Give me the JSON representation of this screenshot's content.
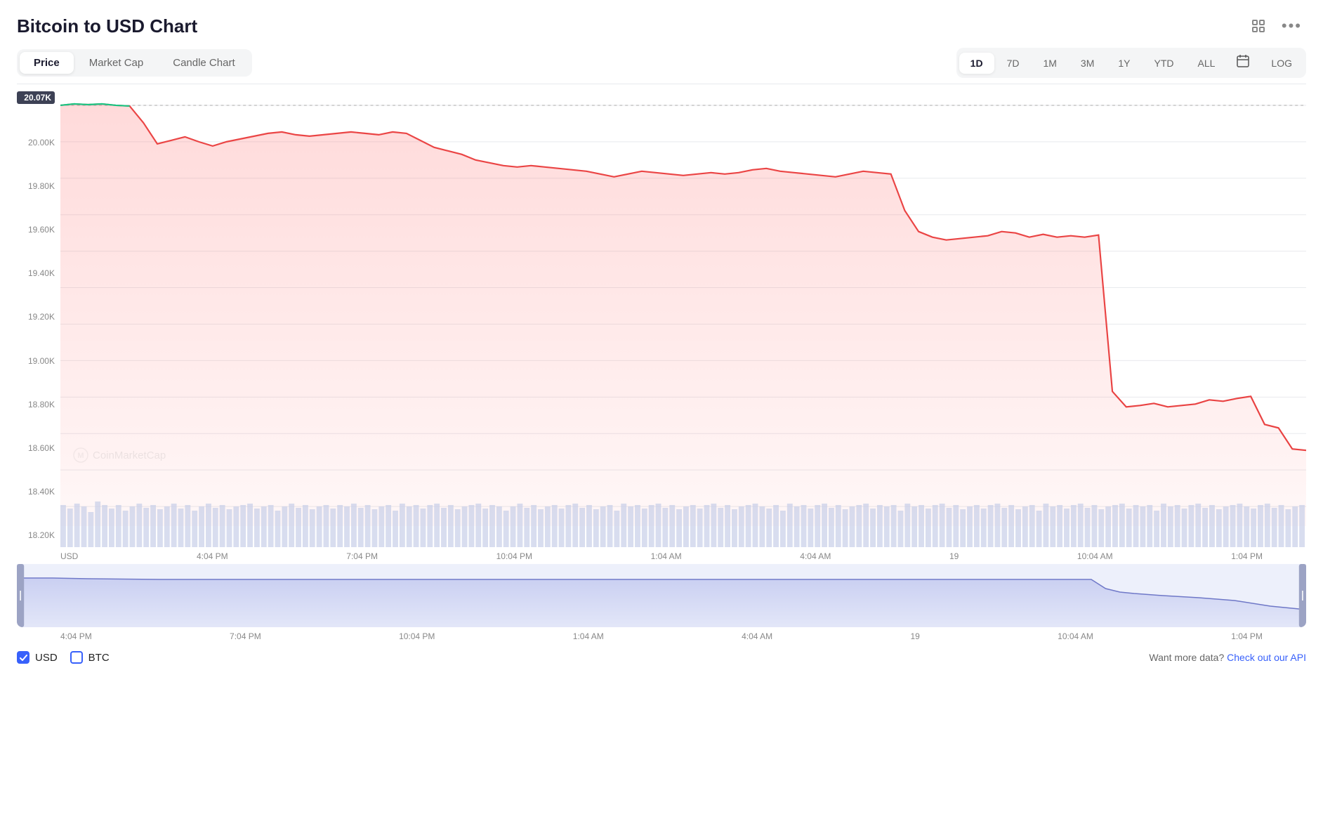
{
  "page": {
    "title": "Bitcoin to USD Chart"
  },
  "tabs": [
    {
      "id": "price",
      "label": "Price",
      "active": true
    },
    {
      "id": "market-cap",
      "label": "Market Cap",
      "active": false
    },
    {
      "id": "candle-chart",
      "label": "Candle Chart",
      "active": false
    }
  ],
  "time_periods": [
    {
      "id": "1d",
      "label": "1D",
      "active": true
    },
    {
      "id": "7d",
      "label": "7D",
      "active": false
    },
    {
      "id": "1m",
      "label": "1M",
      "active": false
    },
    {
      "id": "3m",
      "label": "3M",
      "active": false
    },
    {
      "id": "1y",
      "label": "1Y",
      "active": false
    },
    {
      "id": "ytd",
      "label": "YTD",
      "active": false
    },
    {
      "id": "all",
      "label": "ALL",
      "active": false
    },
    {
      "id": "calendar",
      "label": "📅",
      "active": false
    },
    {
      "id": "log",
      "label": "LOG",
      "active": false
    }
  ],
  "y_axis": [
    {
      "value": "20.07K",
      "highlight": true
    },
    {
      "value": "20.00K",
      "highlight": false
    },
    {
      "value": "19.80K",
      "highlight": false
    },
    {
      "value": "19.60K",
      "highlight": false
    },
    {
      "value": "19.40K",
      "highlight": false
    },
    {
      "value": "19.20K",
      "highlight": false
    },
    {
      "value": "19.00K",
      "highlight": false
    },
    {
      "value": "18.80K",
      "highlight": false
    },
    {
      "value": "18.60K",
      "highlight": false
    },
    {
      "value": "18.40K",
      "highlight": false
    },
    {
      "value": "18.20K",
      "highlight": false
    }
  ],
  "x_axis": [
    {
      "label": "USD"
    },
    {
      "label": "4:04 PM"
    },
    {
      "label": "7:04 PM"
    },
    {
      "label": "10:04 PM"
    },
    {
      "label": "1:04 AM"
    },
    {
      "label": "4:04 AM"
    },
    {
      "label": "19"
    },
    {
      "label": "10:04 AM"
    },
    {
      "label": "1:04 PM"
    }
  ],
  "minimap_x_axis": [
    {
      "label": "4:04 PM"
    },
    {
      "label": "7:04 PM"
    },
    {
      "label": "10:04 PM"
    },
    {
      "label": "1:04 AM"
    },
    {
      "label": "4:04 AM"
    },
    {
      "label": "19"
    },
    {
      "label": "10:04 AM"
    },
    {
      "label": "1:04 PM"
    }
  ],
  "currencies": [
    {
      "id": "usd",
      "label": "USD",
      "checked": true
    },
    {
      "id": "btc",
      "label": "BTC",
      "checked": false
    }
  ],
  "footer": {
    "api_text": "Want more data?",
    "api_link_text": "Check out our API"
  },
  "watermark": "CoinMarketCap",
  "icons": {
    "fullscreen": "⛶",
    "more": "···",
    "expand": "⤢"
  }
}
